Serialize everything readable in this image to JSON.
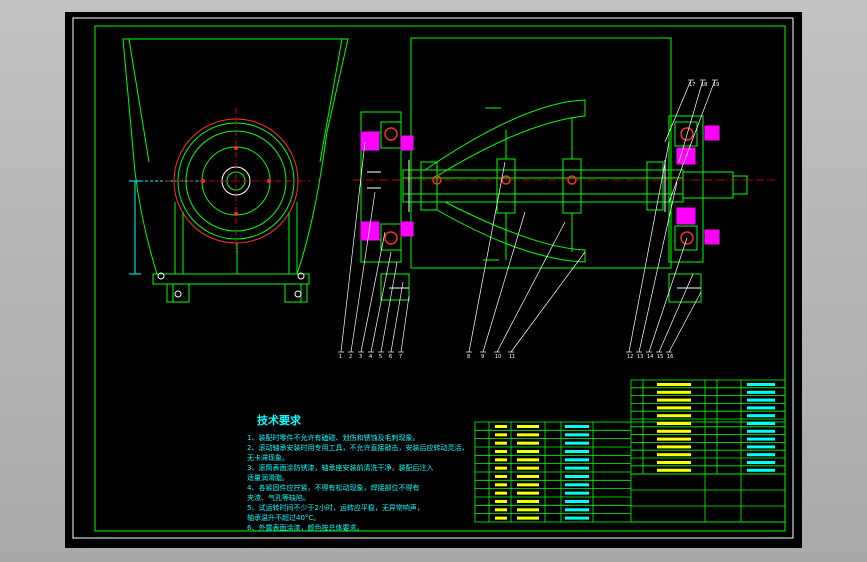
{
  "sheet": {
    "background": "#000000",
    "frame_color": "#ffffff",
    "line_color": "#00ff00",
    "section_fill_color": "#ff00ff",
    "bearing_color": "#ff3030",
    "center_line_color": "#ff0000",
    "annotation_color": "#00ffff",
    "note_color": "#ffffff"
  },
  "tech_notes": {
    "title": "技术要求",
    "lines": [
      "1、装配时零件不允许有磕碰、划伤和锈蚀及毛刺现象。",
      "2、滚动轴承安装时用专用工具，不允许直接敲击，安装后应转动灵活，",
      "   无卡滞现象。",
      "3、滚筒表面涂防锈漆，轴承座安装前清洗干净，装配后注入",
      "   适量润滑脂。",
      "4、各紧固件应拧紧，不得有松动现象，焊接部位不得有",
      "   夹渣、气孔等缺陷。",
      "5、试运转时间不少于2小时，运转应平稳，无异常响声，",
      "   轴承温升不超过40°C。",
      "6、外露表面涂漆，颜色按总体要求。"
    ]
  },
  "leaders": {
    "left_group": [
      "1",
      "2",
      "3",
      "4",
      "5",
      "6",
      "7"
    ],
    "middle_group": [
      "8",
      "9",
      "10",
      "11"
    ],
    "right_group": [
      "12",
      "13",
      "14",
      "15",
      "16"
    ],
    "top_group": [
      "17",
      "18",
      "19"
    ]
  }
}
